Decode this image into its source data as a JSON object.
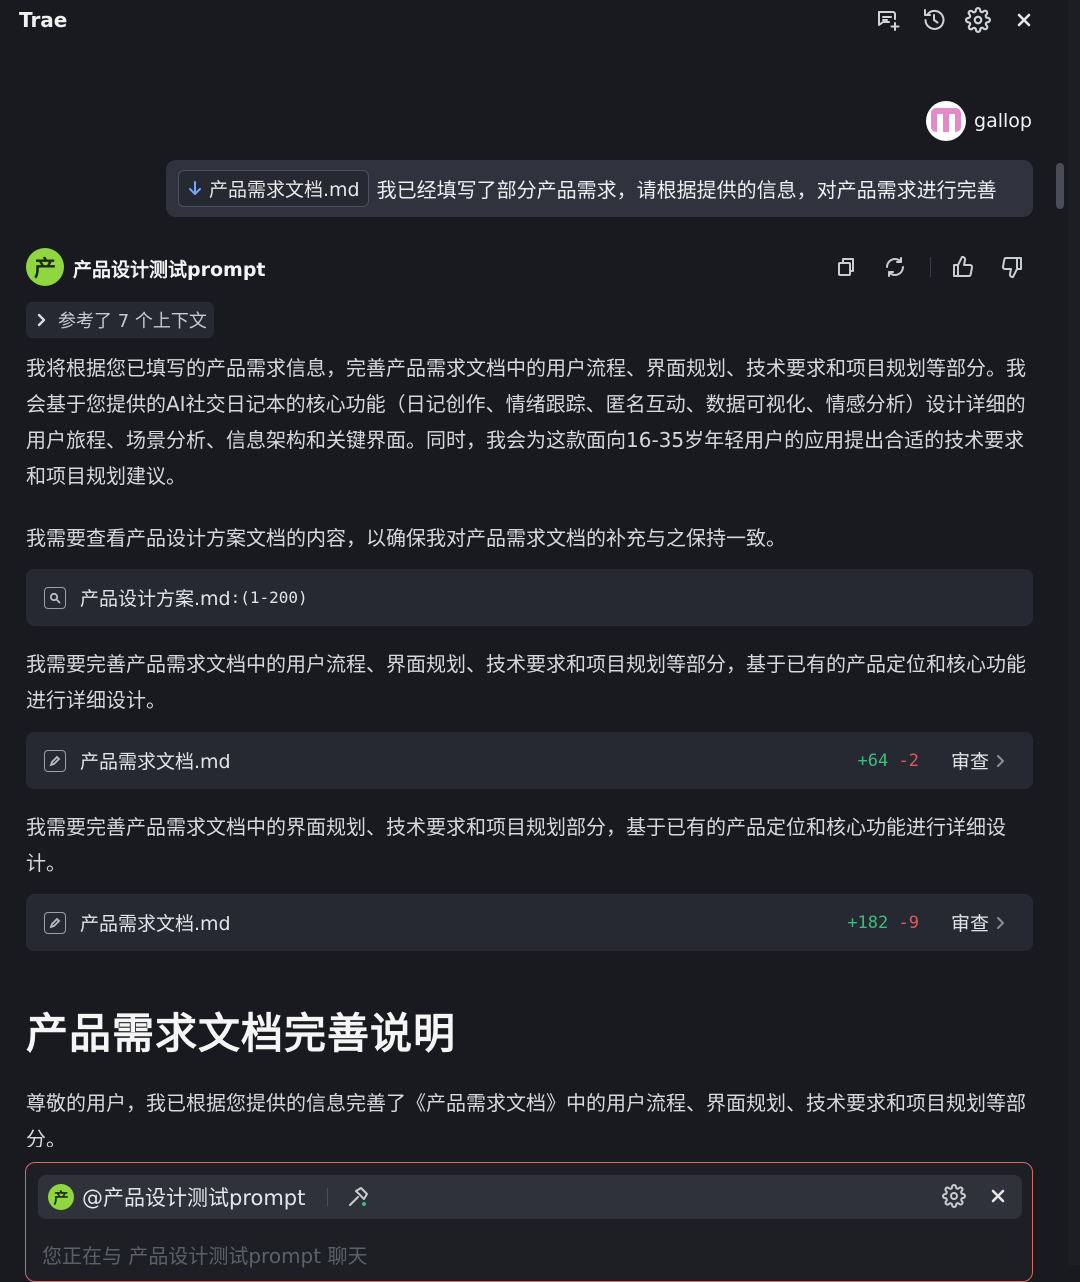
{
  "header": {
    "title": "Trae",
    "icons": [
      "new-chat-icon",
      "history-icon",
      "gear-icon",
      "close-icon"
    ]
  },
  "user": {
    "name": "gallop",
    "message": {
      "attachment": "产品需求文档.md",
      "text": "我已经填写了部分产品需求，请根据提供的信息，对产品需求进行完善"
    }
  },
  "agent": {
    "name": "产品设计测试prompt",
    "logo_char": "产",
    "context_chip": "参考了 7 个上下文",
    "paragraphs": [
      "我将根据您已填写的产品需求信息，完善产品需求文档中的用户流程、界面规划、技术要求和项目规划等部分。我会基于您提供的AI社交日记本的核心功能（日记创作、情绪跟踪、匿名互动、数据可视化、情感分析）设计详细的用户旅程、场景分析、信息架构和关键界面。同时，我会为这款面向16-35岁年轻用户的应用提出合适的技术要求和项目规划建议。",
      "我需要查看产品设计方案文档的内容，以确保我对产品需求文档的补充与之保持一致。",
      "我需要完善产品需求文档中的用户流程、界面规划、技术要求和项目规划等部分，基于已有的产品定位和核心功能进行详细设计。",
      "我需要完善产品需求文档中的界面规划、技术要求和项目规划部分，基于已有的产品定位和核心功能进行详细设计。"
    ],
    "tool_view": {
      "file": "产品设计方案.md",
      "range": ":(1-200)"
    },
    "edit_1": {
      "file": "产品需求文档.md",
      "added": "+64",
      "removed": "-2",
      "review_label": "审查"
    },
    "edit_2": {
      "file": "产品需求文档.md",
      "added": "+182",
      "removed": "-9",
      "review_label": "审查"
    },
    "heading": "产品需求文档完善说明",
    "closing": "尊敬的用户，我已根据您提供的信息完善了《产品需求文档》中的用户流程、界面规划、技术要求和项目规划等部分。"
  },
  "input": {
    "mention": "@产品设计测试prompt",
    "placeholder": "您正在与 产品设计测试prompt 聊天"
  },
  "colors": {
    "background": "#181a1f",
    "agent_green": "#8fd641",
    "diff_add": "#3dbd7d",
    "diff_remove": "#e05a5a",
    "input_border": "#d46a6a"
  }
}
